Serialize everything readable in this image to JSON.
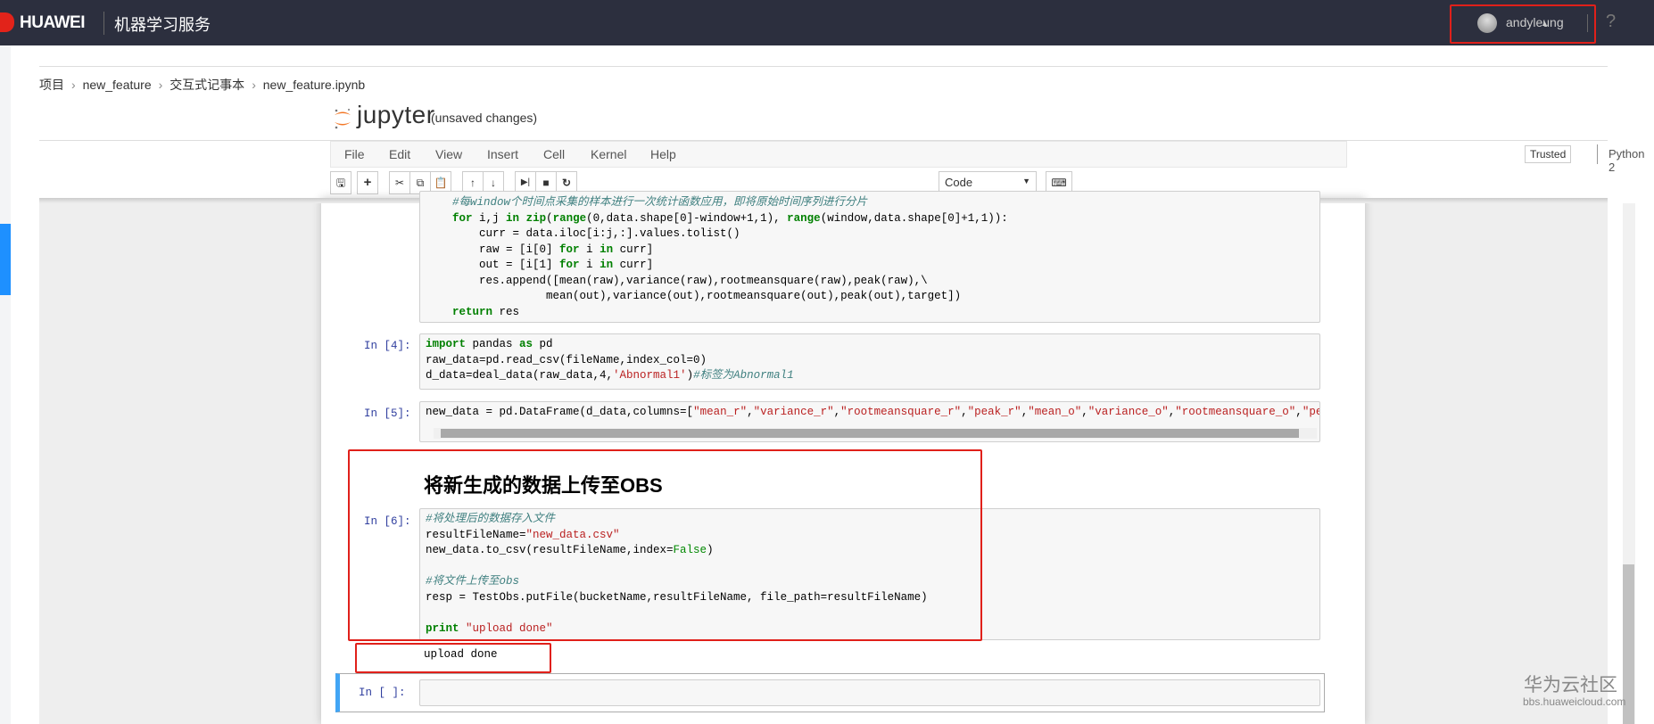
{
  "header": {
    "brand": "HUAWEI",
    "service": "机器学习服务",
    "username": "andyleung",
    "help": "?"
  },
  "breadcrumb": [
    "项目",
    "new_feature",
    "交互式记事本",
    "new_feature.ipynb"
  ],
  "breadcrumb_sep": "›",
  "jupyter": {
    "name": "jupyter",
    "status": "(unsaved changes)"
  },
  "menu": [
    "File",
    "Edit",
    "View",
    "Insert",
    "Cell",
    "Kernel",
    "Help"
  ],
  "trusted": "Trusted",
  "kernel": "Python 2",
  "toolbar": {
    "cell_type": "Code",
    "icons": [
      "save-icon",
      "plus-icon",
      "cut-icon",
      "copy-icon",
      "paste-icon",
      "arrow-up-icon",
      "arrow-down-icon",
      "run-icon",
      "stop-icon",
      "restart-icon",
      "keyboard-icon"
    ]
  },
  "cells": {
    "c3_lines": [
      "#每window个时间点采集的样本进行一次统计函数应用，即将原始时间序列进行分片",
      "for i,j in zip(range(0,data.shape[0]-window+1,1), range(window,data.shape[0]+1,1)):",
      "    curr = data.iloc[i:j,:].values.tolist()",
      "    raw = [i[0] for i in curr]",
      "    out = [i[1] for i in curr]",
      "    res.append([mean(raw),variance(raw),rootmeansquare(raw),peak(raw),\\",
      "              mean(out),variance(out),rootmeansquare(out),peak(out),target])",
      "return res"
    ],
    "c4_prompt": "In  [4]:",
    "c4_lines": [
      "import pandas as pd",
      "raw_data=pd.read_csv(fileName,index_col=0)",
      "d_data=deal_data(raw_data,4,'Abnormal1')#标签为Abnormal1"
    ],
    "c5_prompt": "In  [5]:",
    "c5_line": "new_data = pd.DataFrame(d_data,columns=[\"mean_r\",\"variance_r\",\"rootmeansquare_r\",\"peak_r\",\"mean_o\",\"variance_o\",\"rootmeansquare_o\",\"peak_o\",'ta",
    "md_heading": "将新生成的数据上传至OBS",
    "c6_prompt": "In  [6]:",
    "c6_lines": [
      "#将处理后的数据存入文件",
      "resultFileName=\"new_data.csv\"",
      "new_data.to_csv(resultFileName,index=False)",
      "",
      "#将文件上传至obs",
      "resp = TestObs.putFile(bucketName,resultFileName, file_path=resultFileName)",
      "",
      "print \"upload done\""
    ],
    "c6_output": "upload done",
    "c7_prompt": "In  [ ]:"
  },
  "watermark": {
    "title": "华为云社区",
    "url": "bbs.huaweicloud.com"
  },
  "colors": {
    "header": "#2c2f3e",
    "highlight": "#e0201a",
    "accent": "#42a5f5"
  }
}
